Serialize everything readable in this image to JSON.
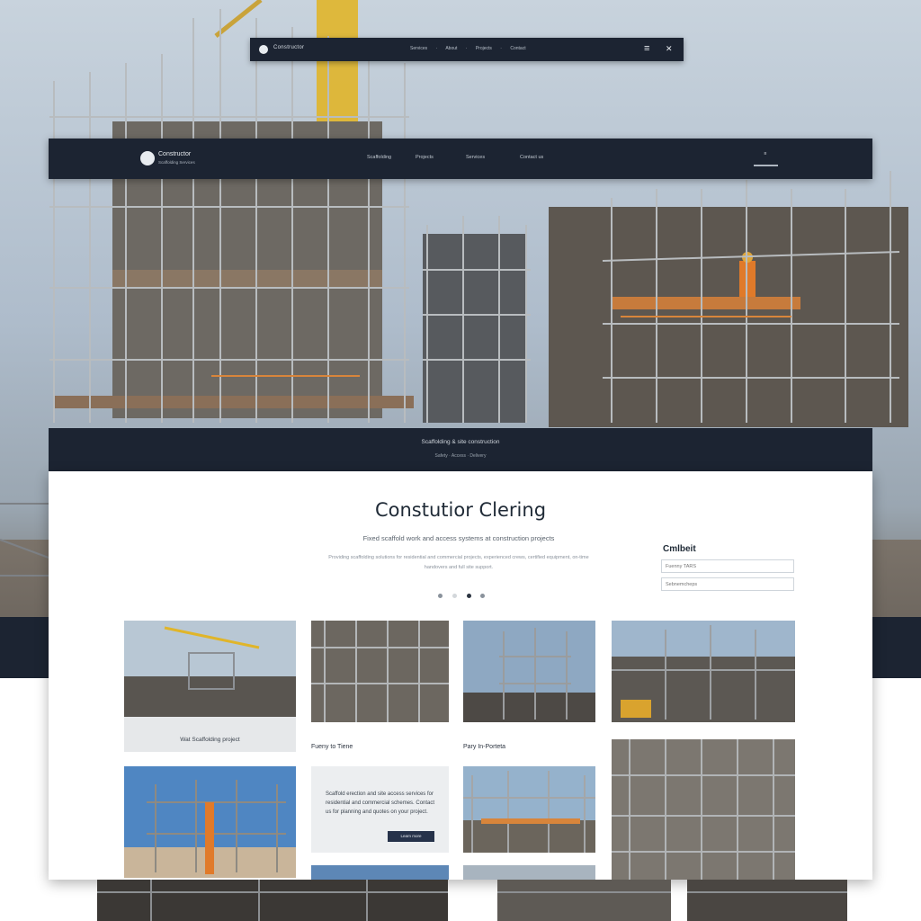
{
  "topbar": {
    "brand": "Constructor",
    "links": "Services · About · Projects · Contact",
    "menu_icon": "hamburger-icon",
    "close_icon": "close-icon"
  },
  "navbar": {
    "brand": "Constructor",
    "sub": "Scaffolding Services",
    "items": [
      "Scaffolding",
      "Projects",
      "Services",
      "Contact us"
    ],
    "button_label": "≡"
  },
  "band": {
    "line1": "Scaffolding & site construction",
    "line2": "Safety · Access · Delivery"
  },
  "hero": {
    "title": "Constutior Clering",
    "tagline": "Fixed scaffold work and access systems at construction projects",
    "description": "Providing scaffolding solutions for residential and commercial projects, experienced crews, certified equipment, on-time handovers and full site support."
  },
  "carousel": {
    "count": 4,
    "active": 2
  },
  "contact": {
    "heading": "Cmlbeit",
    "name_placeholder": "Fuenny TARS",
    "email_placeholder": "Sebnemcheps"
  },
  "gallery": {
    "caption_1": "Wat Scaffolding project",
    "caption_2": "Fueny to Tiene",
    "caption_3": "Pary In-Porteta",
    "text_card": "Scaffold erection and site access services for residential and commercial schemes. Contact us for planning and quotes on your project.",
    "text_card_button": "Learn more"
  },
  "colors": {
    "navy": "#1c2432",
    "card": "#ffffff",
    "accent": "#e07a2a"
  }
}
